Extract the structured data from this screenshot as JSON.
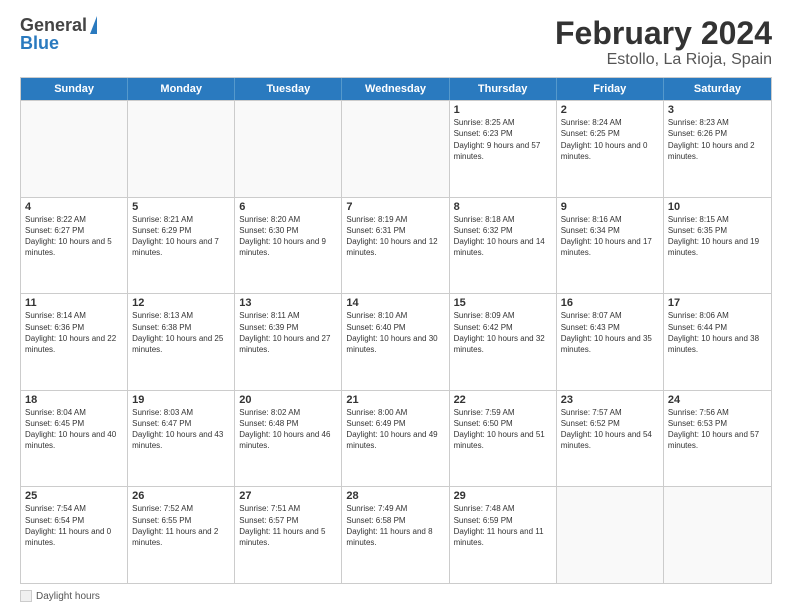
{
  "header": {
    "logo_general": "General",
    "logo_blue": "Blue",
    "title": "February 2024",
    "location": "Estollo, La Rioja, Spain"
  },
  "days_of_week": [
    "Sunday",
    "Monday",
    "Tuesday",
    "Wednesday",
    "Thursday",
    "Friday",
    "Saturday"
  ],
  "footer": {
    "label": "Daylight hours"
  },
  "weeks": [
    {
      "cells": [
        {
          "day": "",
          "empty": true
        },
        {
          "day": "",
          "empty": true
        },
        {
          "day": "",
          "empty": true
        },
        {
          "day": "",
          "empty": true
        },
        {
          "day": "1",
          "sunrise": "Sunrise: 8:25 AM",
          "sunset": "Sunset: 6:23 PM",
          "daylight": "Daylight: 9 hours and 57 minutes."
        },
        {
          "day": "2",
          "sunrise": "Sunrise: 8:24 AM",
          "sunset": "Sunset: 6:25 PM",
          "daylight": "Daylight: 10 hours and 0 minutes."
        },
        {
          "day": "3",
          "sunrise": "Sunrise: 8:23 AM",
          "sunset": "Sunset: 6:26 PM",
          "daylight": "Daylight: 10 hours and 2 minutes."
        }
      ]
    },
    {
      "cells": [
        {
          "day": "4",
          "sunrise": "Sunrise: 8:22 AM",
          "sunset": "Sunset: 6:27 PM",
          "daylight": "Daylight: 10 hours and 5 minutes."
        },
        {
          "day": "5",
          "sunrise": "Sunrise: 8:21 AM",
          "sunset": "Sunset: 6:29 PM",
          "daylight": "Daylight: 10 hours and 7 minutes."
        },
        {
          "day": "6",
          "sunrise": "Sunrise: 8:20 AM",
          "sunset": "Sunset: 6:30 PM",
          "daylight": "Daylight: 10 hours and 9 minutes."
        },
        {
          "day": "7",
          "sunrise": "Sunrise: 8:19 AM",
          "sunset": "Sunset: 6:31 PM",
          "daylight": "Daylight: 10 hours and 12 minutes."
        },
        {
          "day": "8",
          "sunrise": "Sunrise: 8:18 AM",
          "sunset": "Sunset: 6:32 PM",
          "daylight": "Daylight: 10 hours and 14 minutes."
        },
        {
          "day": "9",
          "sunrise": "Sunrise: 8:16 AM",
          "sunset": "Sunset: 6:34 PM",
          "daylight": "Daylight: 10 hours and 17 minutes."
        },
        {
          "day": "10",
          "sunrise": "Sunrise: 8:15 AM",
          "sunset": "Sunset: 6:35 PM",
          "daylight": "Daylight: 10 hours and 19 minutes."
        }
      ]
    },
    {
      "cells": [
        {
          "day": "11",
          "sunrise": "Sunrise: 8:14 AM",
          "sunset": "Sunset: 6:36 PM",
          "daylight": "Daylight: 10 hours and 22 minutes."
        },
        {
          "day": "12",
          "sunrise": "Sunrise: 8:13 AM",
          "sunset": "Sunset: 6:38 PM",
          "daylight": "Daylight: 10 hours and 25 minutes."
        },
        {
          "day": "13",
          "sunrise": "Sunrise: 8:11 AM",
          "sunset": "Sunset: 6:39 PM",
          "daylight": "Daylight: 10 hours and 27 minutes."
        },
        {
          "day": "14",
          "sunrise": "Sunrise: 8:10 AM",
          "sunset": "Sunset: 6:40 PM",
          "daylight": "Daylight: 10 hours and 30 minutes."
        },
        {
          "day": "15",
          "sunrise": "Sunrise: 8:09 AM",
          "sunset": "Sunset: 6:42 PM",
          "daylight": "Daylight: 10 hours and 32 minutes."
        },
        {
          "day": "16",
          "sunrise": "Sunrise: 8:07 AM",
          "sunset": "Sunset: 6:43 PM",
          "daylight": "Daylight: 10 hours and 35 minutes."
        },
        {
          "day": "17",
          "sunrise": "Sunrise: 8:06 AM",
          "sunset": "Sunset: 6:44 PM",
          "daylight": "Daylight: 10 hours and 38 minutes."
        }
      ]
    },
    {
      "cells": [
        {
          "day": "18",
          "sunrise": "Sunrise: 8:04 AM",
          "sunset": "Sunset: 6:45 PM",
          "daylight": "Daylight: 10 hours and 40 minutes."
        },
        {
          "day": "19",
          "sunrise": "Sunrise: 8:03 AM",
          "sunset": "Sunset: 6:47 PM",
          "daylight": "Daylight: 10 hours and 43 minutes."
        },
        {
          "day": "20",
          "sunrise": "Sunrise: 8:02 AM",
          "sunset": "Sunset: 6:48 PM",
          "daylight": "Daylight: 10 hours and 46 minutes."
        },
        {
          "day": "21",
          "sunrise": "Sunrise: 8:00 AM",
          "sunset": "Sunset: 6:49 PM",
          "daylight": "Daylight: 10 hours and 49 minutes."
        },
        {
          "day": "22",
          "sunrise": "Sunrise: 7:59 AM",
          "sunset": "Sunset: 6:50 PM",
          "daylight": "Daylight: 10 hours and 51 minutes."
        },
        {
          "day": "23",
          "sunrise": "Sunrise: 7:57 AM",
          "sunset": "Sunset: 6:52 PM",
          "daylight": "Daylight: 10 hours and 54 minutes."
        },
        {
          "day": "24",
          "sunrise": "Sunrise: 7:56 AM",
          "sunset": "Sunset: 6:53 PM",
          "daylight": "Daylight: 10 hours and 57 minutes."
        }
      ]
    },
    {
      "cells": [
        {
          "day": "25",
          "sunrise": "Sunrise: 7:54 AM",
          "sunset": "Sunset: 6:54 PM",
          "daylight": "Daylight: 11 hours and 0 minutes."
        },
        {
          "day": "26",
          "sunrise": "Sunrise: 7:52 AM",
          "sunset": "Sunset: 6:55 PM",
          "daylight": "Daylight: 11 hours and 2 minutes."
        },
        {
          "day": "27",
          "sunrise": "Sunrise: 7:51 AM",
          "sunset": "Sunset: 6:57 PM",
          "daylight": "Daylight: 11 hours and 5 minutes."
        },
        {
          "day": "28",
          "sunrise": "Sunrise: 7:49 AM",
          "sunset": "Sunset: 6:58 PM",
          "daylight": "Daylight: 11 hours and 8 minutes."
        },
        {
          "day": "29",
          "sunrise": "Sunrise: 7:48 AM",
          "sunset": "Sunset: 6:59 PM",
          "daylight": "Daylight: 11 hours and 11 minutes."
        },
        {
          "day": "",
          "empty": true
        },
        {
          "day": "",
          "empty": true
        }
      ]
    }
  ]
}
